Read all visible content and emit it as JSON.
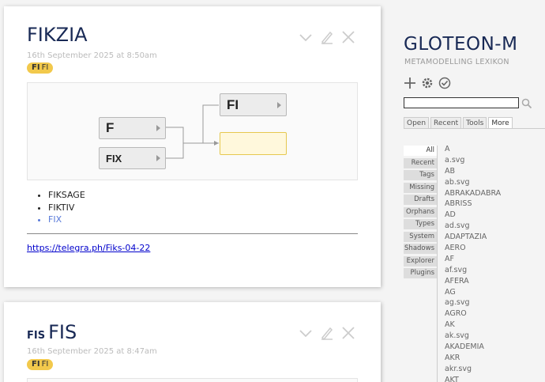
{
  "tiddlers": [
    {
      "title": "FIKZIA",
      "title_prefix": "",
      "subtitle": "16th September 2025 at 8:50am",
      "tag": {
        "bold": "FI",
        "text": "FI"
      },
      "diagram": {
        "left_nodes": [
          "F",
          "FIX"
        ],
        "right_nodes": [
          "FI",
          ""
        ]
      },
      "list": [
        "FIKSAGE",
        "FIKTIV",
        "FIX"
      ],
      "url": "https://telegra.ph/Fiks-04-22"
    },
    {
      "title": "FIS",
      "title_prefix": "FIS",
      "subtitle": "16th September 2025 at 8:47am",
      "tag": {
        "bold": "FI",
        "text": "FI"
      }
    }
  ],
  "sidebar": {
    "title": "GLOTEON-M",
    "subtitle": "METAMODELLING LEXIKON",
    "search_value": "",
    "tabs": [
      "Open",
      "Recent",
      "Tools",
      "More"
    ],
    "active_tab": "More",
    "subtabs": [
      "All",
      "Recent",
      "Tags",
      "Missing",
      "Drafts",
      "Orphans",
      "Types",
      "System",
      "Shadows",
      "Explorer",
      "Plugins"
    ],
    "entries": [
      "A",
      "a.svg",
      "AB",
      "ab.svg",
      "ABRAKADABRA",
      "ABRISS",
      "AD",
      "ad.svg",
      "ADAPTAZIA",
      "AERO",
      "AF",
      "af.svg",
      "AFERA",
      "AG",
      "ag.svg",
      "AGRO",
      "AK",
      "ak.svg",
      "AKADEMIA",
      "AKR",
      "akr.svg",
      "AKT"
    ]
  },
  "colors": {
    "title": "#182955",
    "tag": "#f2c94c",
    "link": "#5778d8"
  }
}
